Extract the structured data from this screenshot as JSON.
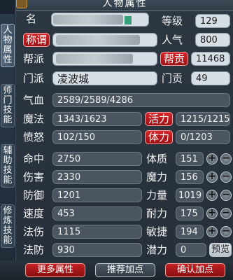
{
  "title": "人物属性",
  "side_tabs": [
    {
      "label": "人物属性",
      "active": true
    },
    {
      "label": "师门技能",
      "active": false
    },
    {
      "label": "辅助技能",
      "active": false
    },
    {
      "label": "修炼技能",
      "active": false
    }
  ],
  "profile": {
    "name_label": "名",
    "title_label": "称谓",
    "guild_label": "帮派",
    "sect_label": "门派",
    "sect_value": "凌波城",
    "level_label": "等级",
    "level_value": "129",
    "popularity_label": "人气",
    "popularity_value": "800",
    "guild_contrib_label": "帮贡",
    "guild_contrib_value": "11468",
    "sect_contrib_label": "门贡",
    "sect_contrib_value": "49"
  },
  "vitals": {
    "hp_label": "气血",
    "hp_value": "2589/2589/4286",
    "mp_label": "魔法",
    "mp_value": "1343/1623",
    "vigor_label": "活力",
    "vigor_value": "1215/1215",
    "rage_label": "愤怒",
    "rage_value": "102/150",
    "stamina_label": "体力",
    "stamina_value": "0/1203"
  },
  "combat_stats": [
    {
      "label": "命中",
      "value": "2750"
    },
    {
      "label": "伤害",
      "value": "2330"
    },
    {
      "label": "防御",
      "value": "1201"
    },
    {
      "label": "速度",
      "value": "453"
    },
    {
      "label": "法伤",
      "value": "1115"
    },
    {
      "label": "法防",
      "value": "930"
    }
  ],
  "base_attrs": [
    {
      "label": "体质",
      "value": "151"
    },
    {
      "label": "魔力",
      "value": "156"
    },
    {
      "label": "力量",
      "value": "1019"
    },
    {
      "label": "耐力",
      "value": "175"
    },
    {
      "label": "敏捷",
      "value": "194"
    }
  ],
  "potential": {
    "label": "潜力",
    "value": "0",
    "preview_label": "预览"
  },
  "plus_symbol": "+",
  "minus_symbol": "−",
  "footer": {
    "more_attrs": "更多属性",
    "recommend": "推荐加点",
    "confirm": "确认加点"
  },
  "colors": {
    "accent_red": "#c22023",
    "panel_bg": "#2c3742"
  }
}
